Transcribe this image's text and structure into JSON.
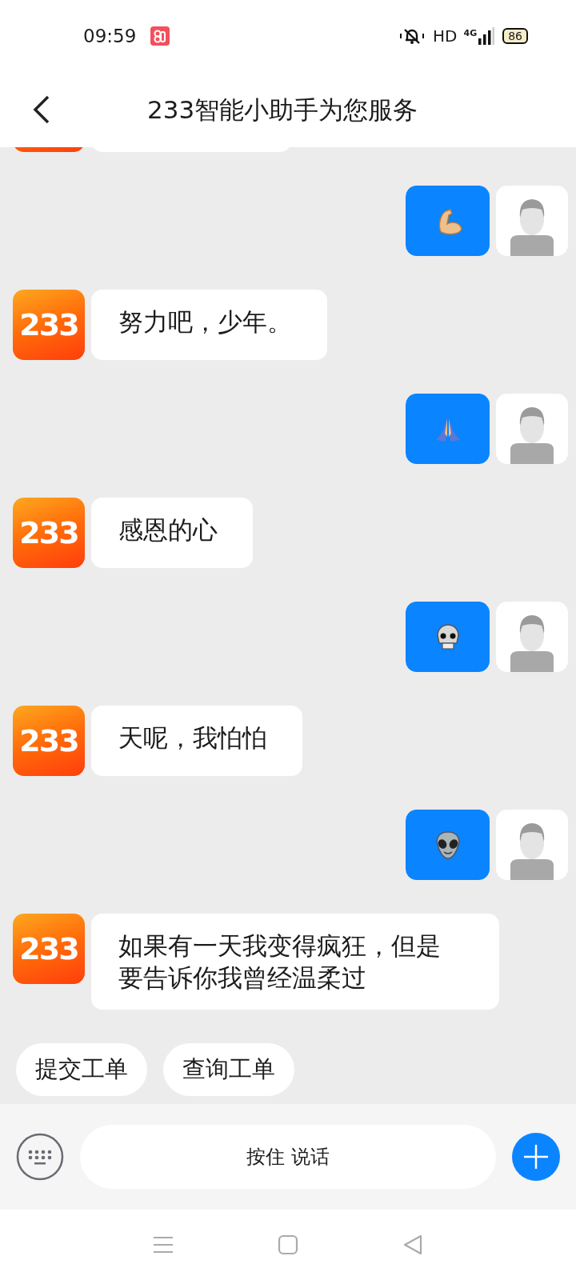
{
  "status_bar": {
    "time": "09:59",
    "network_label": "HD",
    "signal_label": "4G",
    "battery": "86"
  },
  "header": {
    "title": "233智能小助手为您服务"
  },
  "messages": [
    {
      "kind": "cut"
    },
    {
      "kind": "biceps"
    },
    {
      "kind": "received",
      "avatar_label": "233",
      "text": "努力吧，少年。"
    },
    {
      "kind": "pray"
    },
    {
      "kind": "received",
      "avatar_label": "233",
      "text": "感恩的心"
    },
    {
      "kind": "skull"
    },
    {
      "kind": "received",
      "avatar_label": "233",
      "text": "天呢，我怕怕"
    },
    {
      "kind": "alien"
    },
    {
      "kind": "received",
      "avatar_label": "233",
      "text": "如果有一天我变得疯狂，但是要告诉你我曾经温柔过"
    }
  ],
  "quick_replies": [
    "提交工单",
    "查询工单"
  ],
  "input": {
    "placeholder": "按住 说话"
  }
}
